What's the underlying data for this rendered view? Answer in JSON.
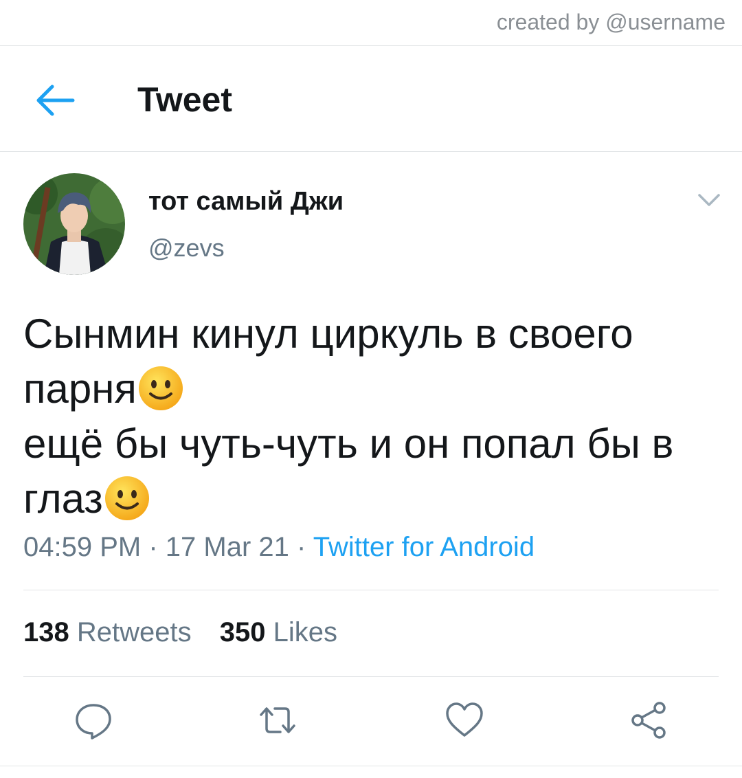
{
  "watermark": "created by @username",
  "header": {
    "title": "Tweet"
  },
  "tweet": {
    "display_name": "тот самый Джи",
    "handle": "@zevs",
    "text_lines": [
      "Сынмин кинул циркуль в своего",
      "парня",
      "ещё бы чуть-чуть и он попал бы в",
      "глаз"
    ],
    "emoji": "slightly-smiling-face",
    "time": "04:59 PM",
    "separator": " · ",
    "date": "17 Mar 21",
    "source": "Twitter for Android",
    "retweets_count": "138",
    "retweets_label": "Retweets",
    "likes_count": "350",
    "likes_label": "Likes"
  },
  "actions": [
    "reply-icon",
    "retweet-icon",
    "like-icon",
    "share-icon"
  ],
  "colors": {
    "accent": "#1da1f2",
    "text": "#14171a",
    "secondary": "#657786",
    "divider": "#e1e4e6"
  }
}
